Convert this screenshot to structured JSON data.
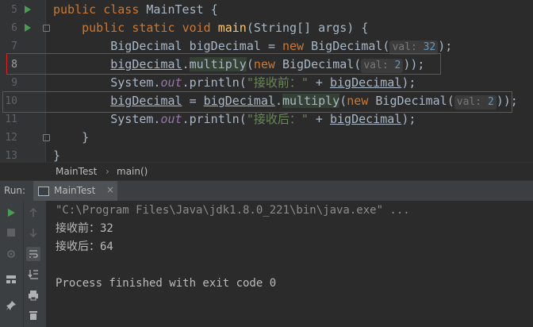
{
  "editor": {
    "lines": [
      {
        "no": "5",
        "kw1": "public",
        "kw2": "class",
        "name": "MainTest",
        "brace": "{"
      },
      {
        "no": "6",
        "kw1": "public",
        "kw2": "static",
        "kw3": "void",
        "method": "main",
        "params": "(String[] args) {"
      },
      {
        "no": "7",
        "type": "BigDecimal",
        "var": "bigDecimal",
        "eq": "=",
        "kw": "new",
        "cls": "BigDecimal(",
        "hint": "val:",
        "num": "32",
        "tail": ");"
      },
      {
        "no": "8",
        "var": "bigDecimal",
        "dot": ".",
        "method": "multi",
        "cursor_part": "ply",
        "open": "(",
        "kw": "new",
        "cls": "BigDecimal(",
        "hint": "val:",
        "num": "2",
        "tail": "));"
      },
      {
        "no": "9",
        "obj": "System.",
        "field": "out",
        "call": ".println(",
        "str": "\"接收前：\"",
        "plus": " + ",
        "var": "bigDecimal",
        "tail": ");"
      },
      {
        "no": "10",
        "var": "bigDecimal",
        "eq": "=",
        "var2": "bigDecimal",
        "dot": ".",
        "method": "multiply",
        "open": "(",
        "kw": "new",
        "cls": "BigDecimal(",
        "hint": "val:",
        "num": "2",
        "tail": "));"
      },
      {
        "no": "11",
        "obj": "System.",
        "field": "out",
        "call": ".println(",
        "str": "\"接收后：\"",
        "plus": " + ",
        "var": "bigDecimal",
        "tail": ");"
      },
      {
        "no": "12",
        "brace": "}"
      },
      {
        "no": "13",
        "brace": "}"
      }
    ]
  },
  "breadcrumb": {
    "class": "MainTest",
    "separator": "›",
    "method": "main()"
  },
  "run_panel": {
    "label": "Run:",
    "tab": "MainTest",
    "close": "×",
    "console": [
      "\"C:\\Program Files\\Java\\jdk1.8.0_221\\bin\\java.exe\" ...",
      "接收前：32",
      "接收后：64",
      "",
      "Process finished with exit code 0"
    ]
  },
  "colors": {
    "background": "#2b2b2b",
    "keyword": "#cc7832",
    "method": "#ffc66d",
    "number": "#6897bb",
    "string": "#6a8759",
    "field": "#9876aa",
    "highlight_box": "#e02020",
    "run_icon": "#499c54"
  },
  "icons": {
    "gutter_run": "run-arrow-icon",
    "rerun": "rerun-icon",
    "stop": "stop-icon",
    "up": "arrow-up-icon",
    "down": "arrow-down-icon",
    "soft_wrap": "soft-wrap-icon",
    "scroll_end": "scroll-to-end-icon",
    "settings": "gear-icon",
    "print": "print-icon",
    "layout": "layout-icon",
    "pin": "pin-icon",
    "trash": "trash-icon"
  }
}
